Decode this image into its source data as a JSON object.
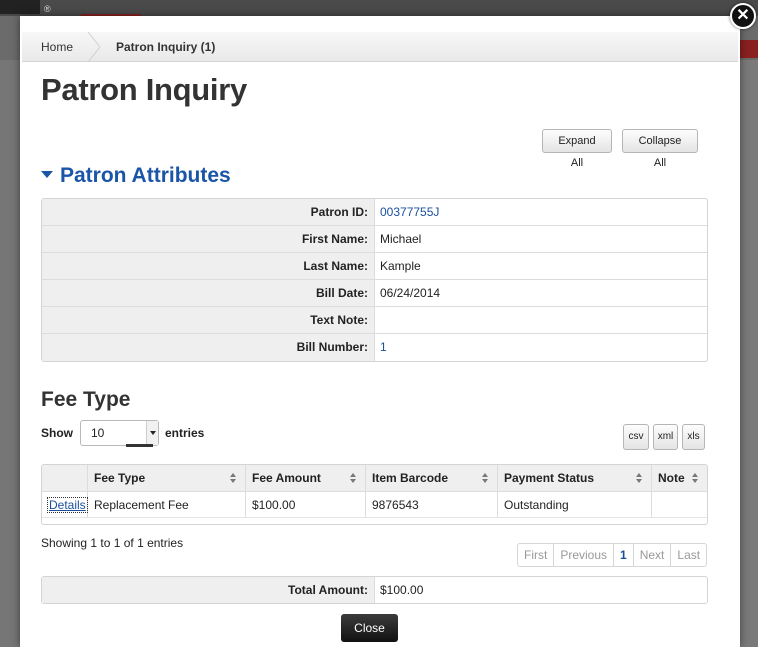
{
  "modal": {
    "close_glyph": "✕"
  },
  "breadcrumb": {
    "home": "Home",
    "current": "Patron Inquiry (1)"
  },
  "page": {
    "title": "Patron Inquiry",
    "expand_all": "Expand All",
    "collapse_all": "Collapse All"
  },
  "patron": {
    "section_title": "Patron Attributes",
    "rows": [
      {
        "label": "Patron ID:",
        "value": "00377755J"
      },
      {
        "label": "First Name:",
        "value": "Michael"
      },
      {
        "label": "Last Name:",
        "value": "Kample"
      },
      {
        "label": "Bill Date:",
        "value": "06/24/2014"
      },
      {
        "label": "Text Note:",
        "value": ""
      },
      {
        "label": "Bill Number:",
        "value": "1"
      }
    ]
  },
  "fees": {
    "section_title": "Fee Type",
    "show_label": "Show",
    "page_size": "10",
    "entries_label": "entries",
    "export": {
      "csv": "csv",
      "xml": "xml",
      "xls": "xls"
    },
    "columns": [
      "",
      "Fee Type",
      "Fee Amount",
      "Item Barcode",
      "Payment Status",
      "Note"
    ],
    "rows": [
      {
        "action": "Details",
        "fee_type": "Replacement Fee",
        "fee_amount": "$100.00",
        "item_barcode": "9876543",
        "payment_status": "Outstanding",
        "note": ""
      }
    ],
    "showing": "Showing 1 to 1 of 1 entries",
    "pager": {
      "first": "First",
      "previous": "Previous",
      "page": "1",
      "next": "Next",
      "last": "Last"
    },
    "total_label": "Total Amount:",
    "total_value": "$100.00"
  },
  "footer": {
    "close": "Close"
  },
  "colors": {
    "accent_blue": "#1a55a7",
    "link_blue": "#1a4f9c",
    "close_button": "#111111"
  }
}
